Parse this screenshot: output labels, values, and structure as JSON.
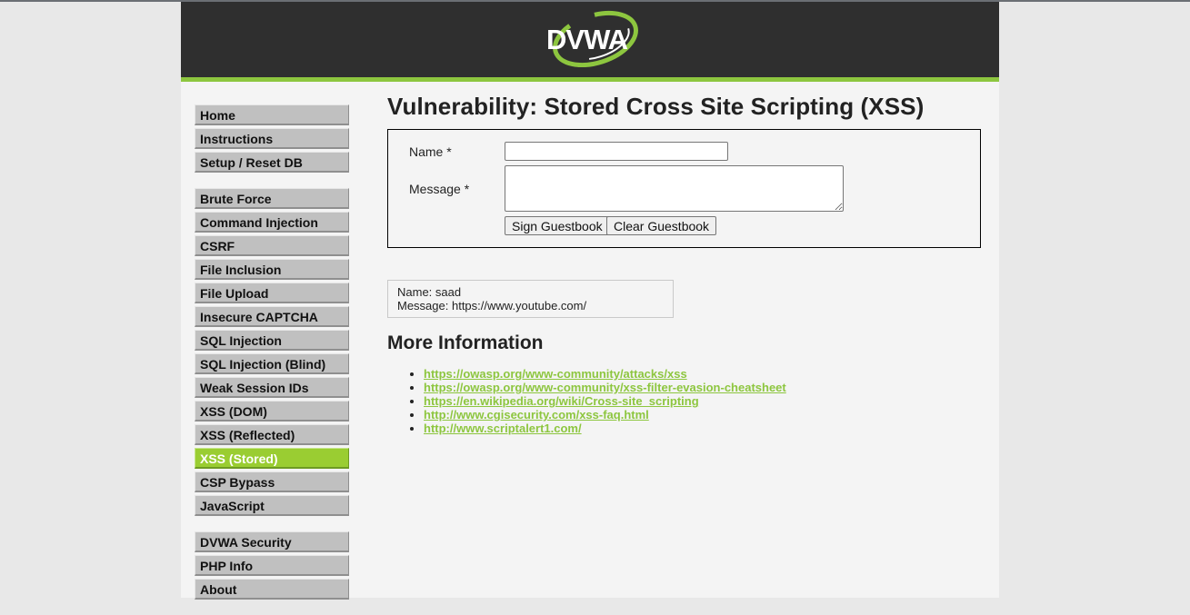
{
  "logo_text": "DVWA",
  "menu": {
    "group1": [
      "Home",
      "Instructions",
      "Setup / Reset DB"
    ],
    "group2": [
      "Brute Force",
      "Command Injection",
      "CSRF",
      "File Inclusion",
      "File Upload",
      "Insecure CAPTCHA",
      "SQL Injection",
      "SQL Injection (Blind)",
      "Weak Session IDs",
      "XSS (DOM)",
      "XSS (Reflected)",
      "XSS (Stored)",
      "CSP Bypass",
      "JavaScript"
    ],
    "group3": [
      "DVWA Security",
      "PHP Info",
      "About"
    ],
    "selected": "XSS (Stored)"
  },
  "page": {
    "title": "Vulnerability: Stored Cross Site Scripting (XSS)",
    "form": {
      "name_label": "Name *",
      "name_value": "",
      "message_label": "Message *",
      "message_value": "",
      "sign_button": "Sign Guestbook",
      "clear_button": "Clear Guestbook"
    },
    "entry": {
      "name_line": "Name: saad",
      "message_line": "Message: https://www.youtube.com/"
    },
    "more_info_heading": "More Information",
    "links": [
      "https://owasp.org/www-community/attacks/xss",
      "https://owasp.org/www-community/xss-filter-evasion-cheatsheet",
      "https://en.wikipedia.org/wiki/Cross-site_scripting",
      "http://www.cgisecurity.com/xss-faq.html",
      "http://www.scriptalert1.com/"
    ]
  },
  "colors": {
    "header_bg": "#2f2f2f",
    "accent_green": "#8dc63f",
    "menu_bg": "#c0c0c0",
    "selected_bg": "#9acd32"
  }
}
